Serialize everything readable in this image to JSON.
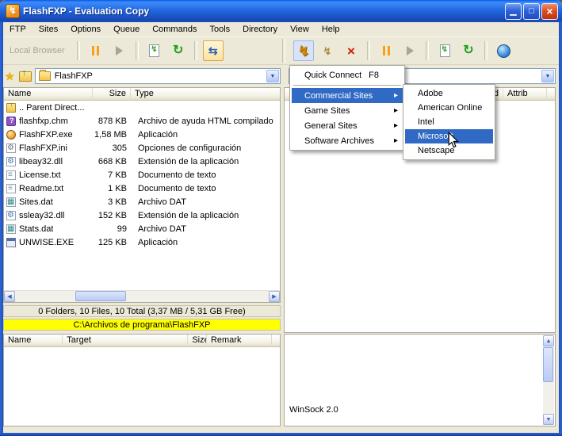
{
  "window": {
    "title": "FlashFXP - Evaluation Copy"
  },
  "titlebar_controls": {
    "minimize": "▁",
    "maximize": "□",
    "close": "×"
  },
  "glyphs": {
    "bolt": "↯",
    "refresh": "↻",
    "swap": "⇆",
    "dropdown": "▼",
    "submenu_arrow": "▸",
    "star": "★",
    "up_arrow": "↑",
    "scroll_left": "◀",
    "scroll_right": "▶",
    "scroll_up": "▲",
    "scroll_down": "▼"
  },
  "menubar": {
    "items": [
      "FTP",
      "Sites",
      "Options",
      "Queue",
      "Commands",
      "Tools",
      "Directory",
      "View",
      "Help"
    ]
  },
  "toolbar": {
    "local_label": "Local Browser"
  },
  "local": {
    "combo_value": "FlashFXP",
    "columns": [
      "Name",
      "Size",
      "Type"
    ],
    "parent_label": ".. Parent Direct...",
    "files": [
      {
        "name": "flashfxp.chm",
        "size": "878 KB",
        "type": "Archivo de ayuda HTML compilado",
        "icon": "icon-help"
      },
      {
        "name": "FlashFXP.exe",
        "size": "1,58 MB",
        "type": "Aplicación",
        "icon": "icon-app"
      },
      {
        "name": "FlashFXP.ini",
        "size": "305",
        "type": "Opciones de configuración",
        "icon": "icon-config"
      },
      {
        "name": "libeay32.dll",
        "size": "668 KB",
        "type": "Extensión de la aplicación",
        "icon": "icon-dll"
      },
      {
        "name": "License.txt",
        "size": "7 KB",
        "type": "Documento de texto",
        "icon": "icon-text"
      },
      {
        "name": "Readme.txt",
        "size": "1 KB",
        "type": "Documento de texto",
        "icon": "icon-text"
      },
      {
        "name": "Sites.dat",
        "size": "3 KB",
        "type": "Archivo DAT",
        "icon": "icon-dat"
      },
      {
        "name": "ssleay32.dll",
        "size": "152 KB",
        "type": "Extensión de la aplicación",
        "icon": "icon-dll"
      },
      {
        "name": "Stats.dat",
        "size": "99",
        "type": "Archivo DAT",
        "icon": "icon-dat"
      },
      {
        "name": "UNWISE.EXE",
        "size": "125 KB",
        "type": "Aplicación",
        "icon": "icon-app2"
      }
    ],
    "status": "0 Folders, 10 Files, 10 Total (3,37 MB / 5,31 GB Free)",
    "path": "C:\\Archivos de programa\\FlashFXP"
  },
  "remote": {
    "columns": [
      "d",
      "Attrib"
    ],
    "log": "WinSock 2.0"
  },
  "site_menu": {
    "quick_connect": "Quick Connect",
    "quick_connect_shortcut": "F8",
    "groups": [
      "Commercial Sites",
      "Game Sites",
      "General Sites",
      "Software Archives"
    ]
  },
  "submenu": {
    "items": [
      "Adobe",
      "American Online",
      "Intel",
      "Microsoft",
      "Netscape"
    ]
  },
  "queue": {
    "columns": [
      "Name",
      "Target",
      "Size",
      "Remark"
    ]
  }
}
